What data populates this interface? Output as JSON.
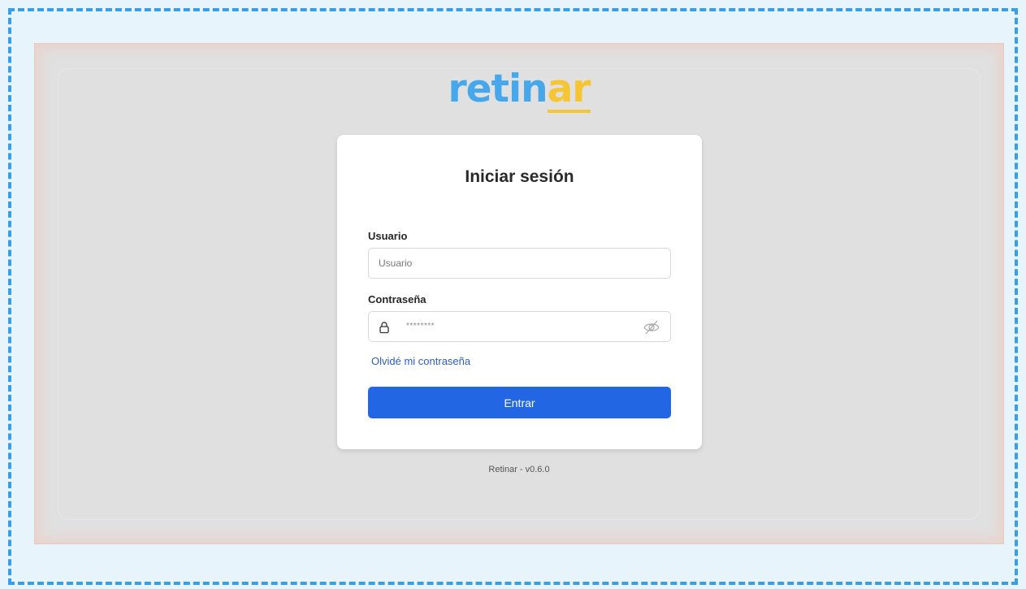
{
  "brand": {
    "logo_main": "retin",
    "logo_accent": "ar",
    "color_main": "#46a8ea",
    "color_accent": "#f6c533"
  },
  "login": {
    "title": "Iniciar sesión",
    "username": {
      "label": "Usuario",
      "placeholder": "Usuario",
      "value": ""
    },
    "password": {
      "label": "Contraseña",
      "value": "********",
      "lock_icon": "lock-icon",
      "toggle_icon": "eye-slash-icon"
    },
    "forgot_link": "Olvidé mi contraseña",
    "submit_label": "Entrar",
    "submit_color": "#2266e3"
  },
  "footer": {
    "version_text": "Retinar - v0.6.0"
  }
}
